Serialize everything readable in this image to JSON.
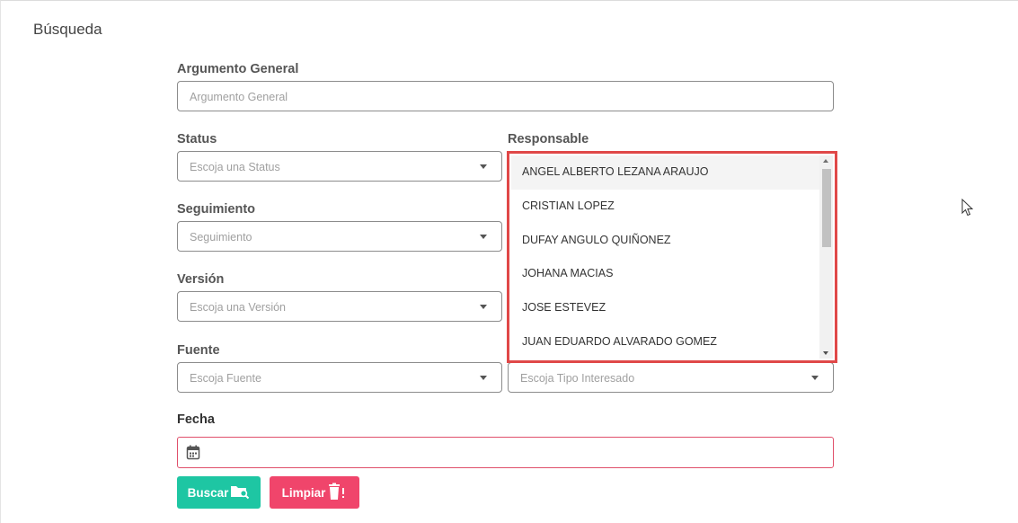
{
  "panel": {
    "title": "Búsqueda"
  },
  "form": {
    "general": {
      "label": "Argumento General",
      "placeholder": "Argumento General"
    },
    "status": {
      "label": "Status",
      "placeholder": "Escoja una Status"
    },
    "responsable": {
      "label": "Responsable"
    },
    "seguimiento": {
      "label": "Seguimiento",
      "placeholder": "Seguimiento"
    },
    "version": {
      "label": "Versión",
      "placeholder": "Escoja una Versión"
    },
    "fuente": {
      "label": "Fuente",
      "placeholder": "Escoja Fuente"
    },
    "tipo_interesado": {
      "placeholder": "Escoja Tipo Interesado"
    },
    "fecha": {
      "label": "Fecha",
      "icon": "calendar-icon"
    }
  },
  "dropdown": {
    "options": [
      "ANGEL ALBERTO LEZANA ARAUJO",
      "CRISTIAN LOPEZ",
      "DUFAY ANGULO QUIÑONEZ",
      "JOHANA MACIAS",
      "JOSE ESTEVEZ",
      "JUAN EDUARDO ALVARADO GOMEZ"
    ],
    "highlighted_index": 0,
    "highlight_color": "#e04848"
  },
  "buttons": {
    "search": {
      "label": "Buscar",
      "icon": "folder-search-icon",
      "color": "#1ec6a3"
    },
    "clear": {
      "label": "Limpiar",
      "icon": "trash-icon",
      "color": "#f0456b"
    }
  }
}
